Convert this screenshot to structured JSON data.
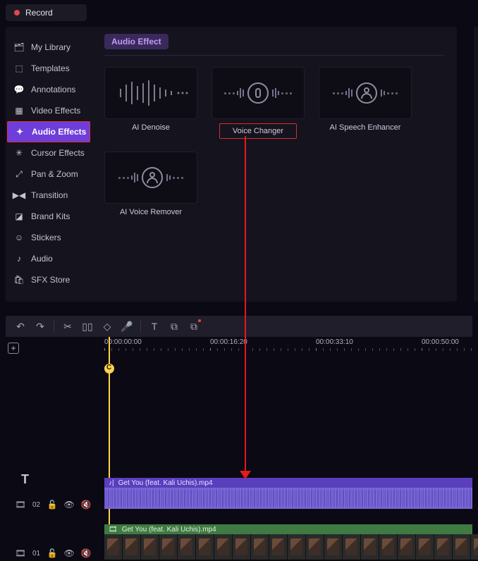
{
  "record": {
    "label": "Record"
  },
  "sidebar": {
    "items": [
      {
        "label": "My Library",
        "icon": "🗂"
      },
      {
        "label": "Templates",
        "icon": "⬚"
      },
      {
        "label": "Annotations",
        "icon": "💬"
      },
      {
        "label": "Video Effects",
        "icon": "▦"
      },
      {
        "label": "Audio Effects",
        "icon": "✦"
      },
      {
        "label": "Cursor Effects",
        "icon": "✳"
      },
      {
        "label": "Pan & Zoom",
        "icon": "⤢"
      },
      {
        "label": "Transition",
        "icon": "▶◀"
      },
      {
        "label": "Brand Kits",
        "icon": "◪"
      },
      {
        "label": "Stickers",
        "icon": "☺"
      },
      {
        "label": "Audio",
        "icon": "♪"
      },
      {
        "label": "SFX Store",
        "icon": "🛍"
      }
    ],
    "selected_index": 4
  },
  "content": {
    "header_pill": "Audio Effect",
    "effects": [
      {
        "label": "AI Denoise"
      },
      {
        "label": "Voice Changer"
      },
      {
        "label": "AI Speech Enhancer"
      },
      {
        "label": "AI Voice Remover"
      }
    ],
    "highlight_index": 1
  },
  "timeline": {
    "ruler": [
      "00:00:00:00",
      "00:00:16:20",
      "00:00:33:10",
      "00:00:50:00"
    ],
    "playhead_label": "C",
    "tracks": [
      {
        "num": "02",
        "clip_type": "audio",
        "clip_name": "Get You (feat. Kali Uchis).mp4"
      },
      {
        "num": "01",
        "clip_type": "video",
        "clip_name": "Get You (feat. Kali Uchis).mp4"
      }
    ]
  },
  "track_icons": {
    "film": "🎞",
    "lock": "🔓",
    "eye": "👁",
    "mute": "🔇",
    "clip_audio": "♪|",
    "clip_video": "🎞"
  }
}
